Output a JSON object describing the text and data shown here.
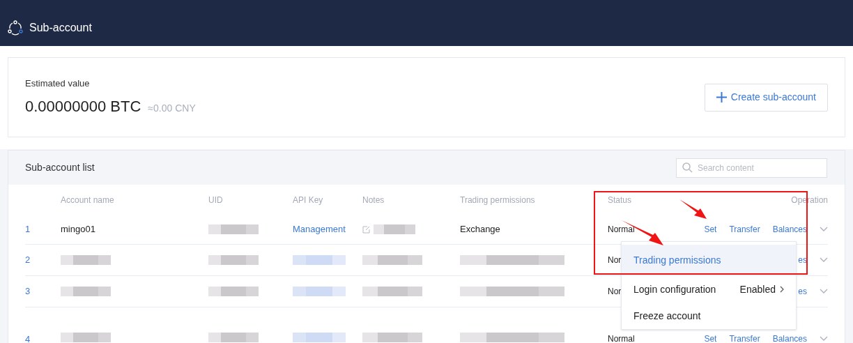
{
  "header": {
    "title": "Sub-account"
  },
  "summary": {
    "label": "Estimated value",
    "value": "0.00000000 BTC",
    "approx": "≈0.00 CNY",
    "create_button": "Create sub-account"
  },
  "list": {
    "title": "Sub-account list",
    "search": {
      "placeholder": "Search content"
    },
    "columns": [
      "Account name",
      "UID",
      "API Key",
      "Notes",
      "Trading permissions",
      "Status",
      "Operation"
    ],
    "rows": [
      {
        "index": "1",
        "account": {
          "kind": "text",
          "text": "mingo01"
        },
        "uid": {
          "kind": "blurred"
        },
        "api_key": {
          "kind": "link",
          "text": "Management"
        },
        "notes": {
          "kind": "edit"
        },
        "trading": {
          "kind": "text",
          "text": "Exchange"
        },
        "status": "Normal",
        "operations": [
          "Set",
          "Transfer",
          "Balances"
        ]
      },
      {
        "index": "2",
        "account": {
          "kind": "blurred"
        },
        "uid": {
          "kind": "blurred"
        },
        "api_key": {
          "kind": "blurred_link"
        },
        "notes": {
          "kind": "blurred"
        },
        "trading": {
          "kind": "blurred"
        },
        "status": "Nor",
        "operations": [
          "es"
        ]
      },
      {
        "index": "3",
        "account": {
          "kind": "blurred"
        },
        "uid": {
          "kind": "blurred"
        },
        "api_key": {
          "kind": "blurred_link"
        },
        "notes": {
          "kind": "blurred"
        },
        "trading": {
          "kind": "blurred"
        },
        "status": "Nor",
        "operations": [
          "es"
        ]
      },
      {
        "index": "4",
        "account": {
          "kind": "blurred"
        },
        "uid": {
          "kind": "blurred"
        },
        "api_key": {
          "kind": "blurred_link"
        },
        "notes": {
          "kind": "blurred"
        },
        "trading": {
          "kind": "blurred"
        },
        "status": "Normal",
        "operations": [
          "Set",
          "Transfer",
          "Balances"
        ]
      }
    ]
  },
  "dropdown": {
    "items": [
      {
        "label": "Trading permissions",
        "selected": true
      },
      {
        "label": "Login configuration",
        "selected": false,
        "value": "Enabled"
      },
      {
        "label": "Freeze account",
        "selected": false
      }
    ]
  }
}
